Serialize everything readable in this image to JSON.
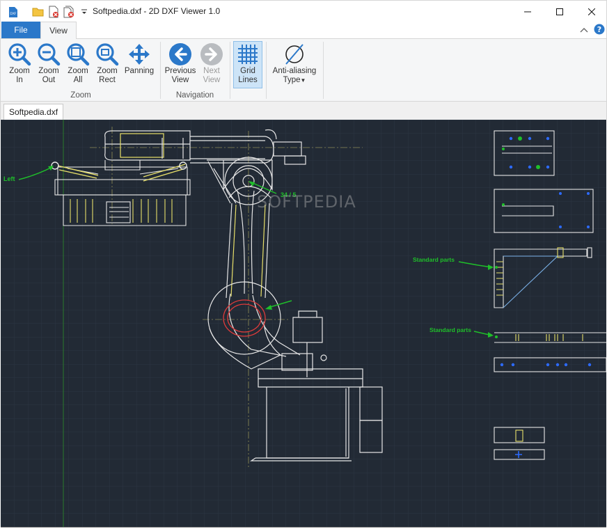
{
  "window": {
    "title": "Softpedia.dxf - 2D DXF Viewer 1.0",
    "app_icon_text": "DXF"
  },
  "ribbon_tabs": {
    "file": "File",
    "view": "View"
  },
  "ribbon": {
    "zoom_group": {
      "label": "Zoom",
      "zoom_in": [
        "Zoom",
        "In"
      ],
      "zoom_out": [
        "Zoom",
        "Out"
      ],
      "zoom_all": [
        "Zoom",
        "All"
      ],
      "zoom_rect": [
        "Zoom",
        "Rect"
      ],
      "panning": "Panning"
    },
    "navigation_group": {
      "label": "Navigation",
      "previous_view": [
        "Previous",
        "View"
      ],
      "next_view": [
        "Next",
        "View"
      ]
    },
    "grid_lines": [
      "Grid",
      "Lines"
    ],
    "anti_aliasing": [
      "Anti-aliasing",
      "Type"
    ]
  },
  "document_tab": "Softpedia.dxf",
  "watermark": "SOFTPEDIA",
  "drawing_labels": {
    "left": "Left",
    "fraction": "34 / 5",
    "standard_parts_1": "Standard parts",
    "standard_parts_2": "Standard parts"
  },
  "colors": {
    "accent": "#2b78c9",
    "canvas_bg": "#222a35",
    "grid": "#2c3542",
    "line_white": "#e6e6e6",
    "line_yellow": "#e8e06a",
    "line_red": "#e03b3b",
    "line_green": "#1fbf2a",
    "line_blue": "#2d6bff"
  }
}
